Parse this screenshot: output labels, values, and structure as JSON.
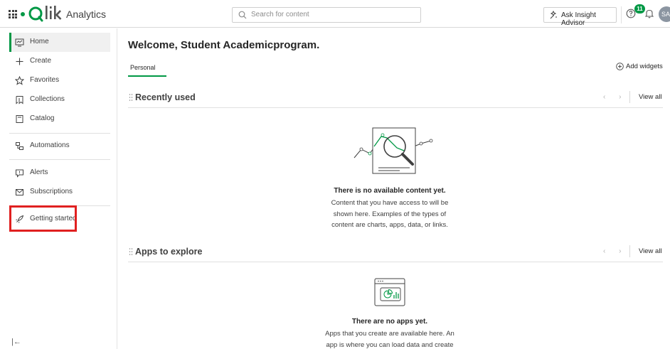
{
  "header": {
    "logo_text": "Qlik",
    "app_name": "Analytics",
    "search_placeholder": "Search for content",
    "insight_button": "Ask Insight Advisor",
    "notification_count": "11",
    "avatar_initials": "SA",
    "icons": [
      "grid-menu-icon",
      "search-icon",
      "insight-icon",
      "help-icon",
      "bell-icon"
    ]
  },
  "sidebar": {
    "items": [
      {
        "label": "Home",
        "icon": "home-icon",
        "active": true
      },
      {
        "label": "Create",
        "icon": "plus-icon"
      },
      {
        "label": "Favorites",
        "icon": "star-icon"
      },
      {
        "label": "Collections",
        "icon": "bookmark-icon"
      },
      {
        "label": "Catalog",
        "icon": "catalog-icon"
      },
      {
        "label": "Automations",
        "icon": "automation-icon"
      },
      {
        "label": "Alerts",
        "icon": "alert-icon"
      },
      {
        "label": "Subscriptions",
        "icon": "mail-icon"
      },
      {
        "label": "Getting started",
        "icon": "rocket-icon"
      }
    ],
    "highlight_color": "#e02020"
  },
  "main": {
    "welcome": "Welcome, Student Academicprogram.",
    "tab": "Personal",
    "add_widgets": "Add widgets",
    "recently_used": {
      "title": "Recently used",
      "view_all": "View all",
      "empty_title": "There is no available content yet.",
      "empty_text": "Content that you have access to will be shown here. Examples of the types of content are charts, apps, data, or links."
    },
    "apps_to_explore": {
      "title": "Apps to explore",
      "view_all": "View all",
      "empty_title": "There are no apps yet.",
      "empty_text": "Apps that you create are available here. An app is where you can load data and create"
    }
  },
  "colors": {
    "brand_green": "#009845",
    "text": "#404040"
  }
}
